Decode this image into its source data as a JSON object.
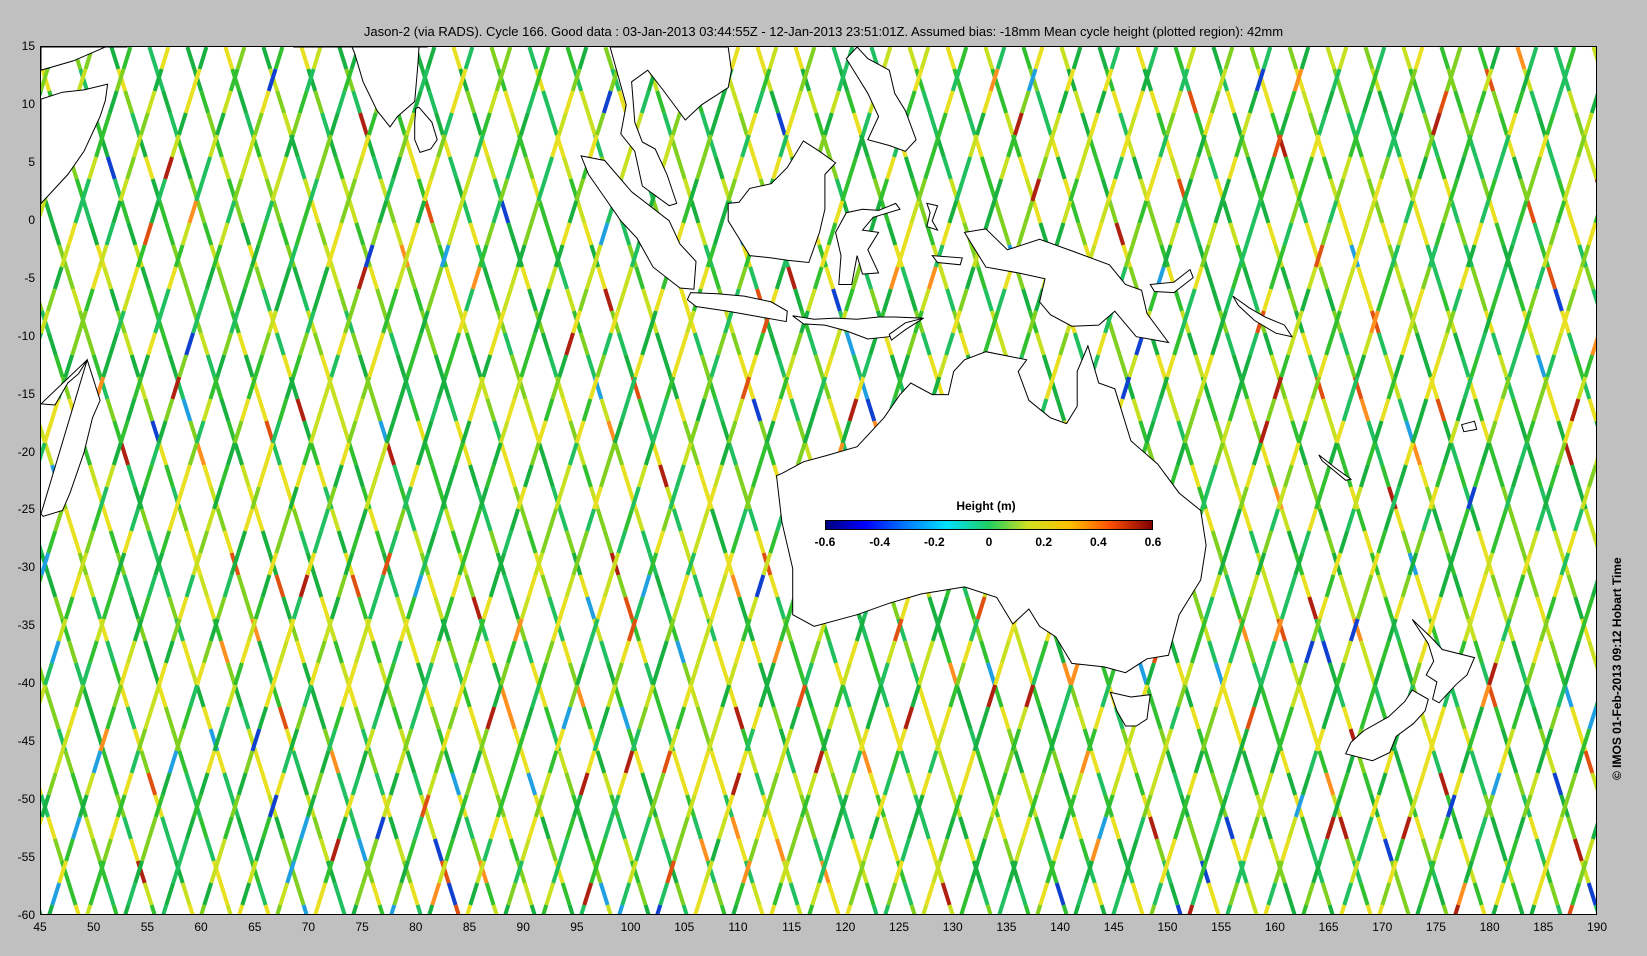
{
  "title": "Jason-2 (via RADS). Cycle 166. Good data : 03-Jan-2013 03:44:55Z - 12-Jan-2013 23:51:01Z. Assumed bias: -18mm  Mean cycle height (plotted region): 42mm",
  "copyright": "© IMOS 01-Feb-2013 09:12 Hobart Time",
  "map": {
    "lon_range": [
      45,
      190
    ],
    "lat_range": [
      -60,
      15
    ],
    "lon_ticks": [
      "45",
      "50",
      "55",
      "60",
      "65",
      "70",
      "75",
      "80",
      "85",
      "90",
      "95",
      "100",
      "105",
      "110",
      "115",
      "120",
      "125",
      "130",
      "135",
      "140",
      "145",
      "150",
      "155",
      "160",
      "165",
      "170",
      "175",
      "180",
      "185",
      "190"
    ],
    "lat_ticks": [
      "15",
      "10",
      "5",
      "0",
      "-5",
      "-10",
      "-15",
      "-20",
      "-25",
      "-30",
      "-35",
      "-40",
      "-45",
      "-50",
      "-55",
      "-60"
    ],
    "track_colors": [
      "#18b040",
      "#30c030",
      "#80d020",
      "#c8e020",
      "#e8e020",
      "#20c060"
    ],
    "anomaly_colors": [
      "#ff9020",
      "#e05010",
      "#b02010",
      "#20a0e0",
      "#1040d0"
    ],
    "land_color": "#ffffff",
    "coast_color": "#000000"
  },
  "colorbar": {
    "label": "Height (m)",
    "ticks": [
      "-0.6",
      "-0.4",
      "-0.2",
      "0",
      "0.2",
      "0.4",
      "0.6"
    ],
    "range": [
      -0.6,
      0.6
    ]
  }
}
